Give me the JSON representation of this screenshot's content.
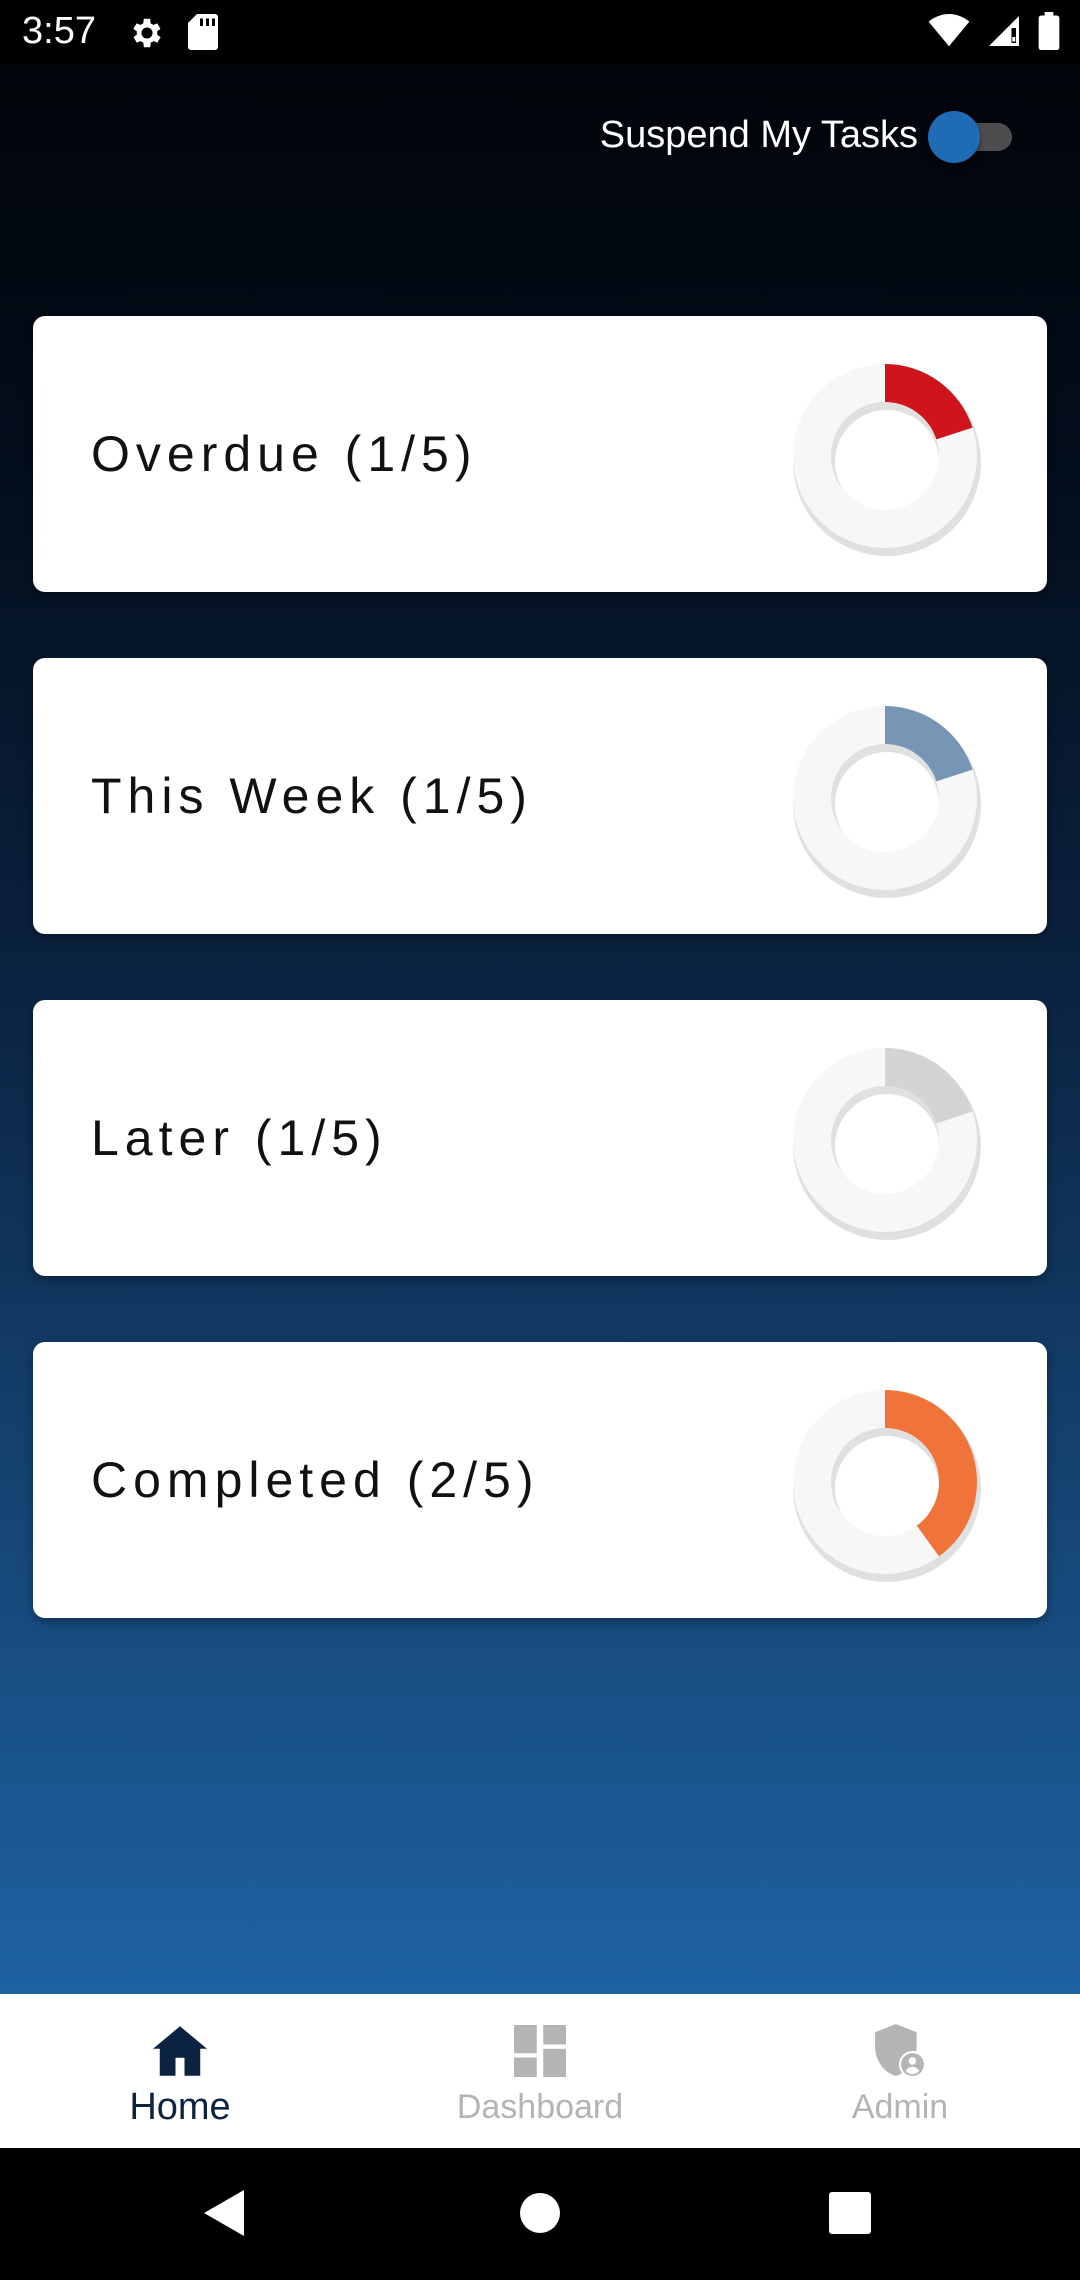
{
  "status_bar": {
    "time": "3:57",
    "left_icons": [
      "settings-icon",
      "sd-card-icon"
    ],
    "right_icons": [
      "wifi-icon",
      "signal-icon",
      "battery-icon"
    ]
  },
  "header": {
    "suspend_label": "Suspend My Tasks",
    "suspend_toggle": {
      "on": false,
      "thumb_color": "#1f6bb5",
      "track_color": "#4d4d4f"
    }
  },
  "cards": [
    {
      "label": "Overdue (1/5)",
      "fraction": 0.2,
      "color": "#d0141b"
    },
    {
      "label": "This Week (1/5)",
      "fraction": 0.2,
      "color": "#7796b5"
    },
    {
      "label": "Later (1/5)",
      "fraction": 0.2,
      "color": "#d3d4d6"
    },
    {
      "label": "Completed (2/5)",
      "fraction": 0.4,
      "color": "#f0733a"
    }
  ],
  "bottom_nav": {
    "items": [
      {
        "label": "Home",
        "icon": "home-icon",
        "active": true
      },
      {
        "label": "Dashboard",
        "icon": "dashboard-icon",
        "active": false
      },
      {
        "label": "Admin",
        "icon": "admin-shield-icon",
        "active": false
      }
    ]
  },
  "system_nav": [
    "back-icon",
    "home-circle-icon",
    "recents-icon"
  ],
  "colors": {
    "gradient_top": "#010409",
    "gradient_bottom": "#1e62a3",
    "nav_active": "#0c2442",
    "nav_inactive": "#b4b4b4",
    "ring_track": "#f7f7f7"
  }
}
